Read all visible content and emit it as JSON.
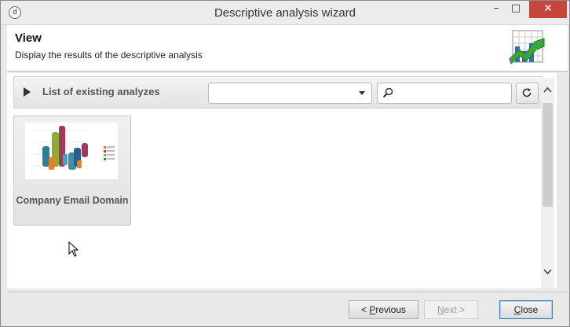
{
  "window": {
    "title": "Descriptive analysis wizard",
    "minimize_glyph": "–",
    "maximize_glyph": "□",
    "close_glyph": "✕",
    "app_icon_glyph": "d"
  },
  "header": {
    "title": "View",
    "subtitle": "Display the results of the descriptive analysis"
  },
  "toolbar": {
    "label": "List of existing analyzes",
    "select_value": "",
    "search_value": ""
  },
  "cards": [
    {
      "label": "Company Email Domain"
    }
  ],
  "footer": {
    "previous_prefix": "< ",
    "previous_mnemonic": "P",
    "previous_rest": "revious",
    "next_mnemonic": "N",
    "next_rest": "ext >",
    "close_mnemonic": "C",
    "close_rest": "lose"
  },
  "colors": {
    "title_bar_close": "#c7463b",
    "default_button_border": "#3c7fb1",
    "logo_green": "#3aa63a",
    "logo_blue": "#2f6fb8"
  }
}
